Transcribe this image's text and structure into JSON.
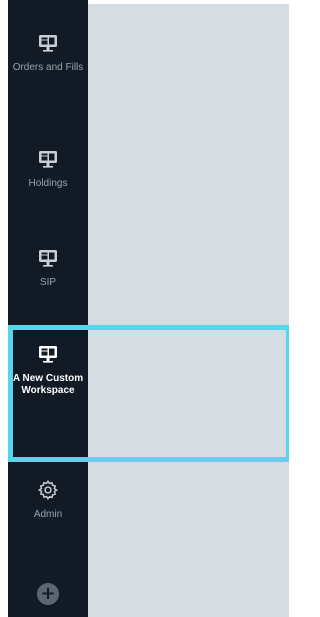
{
  "sidebar": {
    "items": [
      {
        "label": "Orders and Fills",
        "icon": "monitor-icon"
      },
      {
        "label": "Holdings",
        "icon": "monitor-icon"
      },
      {
        "label": "SIP",
        "icon": "monitor-icon"
      },
      {
        "label": "A New Custom Workspace",
        "icon": "monitor-icon",
        "active": true
      },
      {
        "label": "Admin",
        "icon": "gear-icon"
      }
    ],
    "add_button": {
      "icon": "plus-icon",
      "glyph": "+"
    }
  },
  "colors": {
    "sidebar_bg": "#121a26",
    "content_bg": "#d5dce2",
    "active_outline": "#56d6ea",
    "label_inactive": "#9aa4ae",
    "label_active": "#ffffff"
  }
}
